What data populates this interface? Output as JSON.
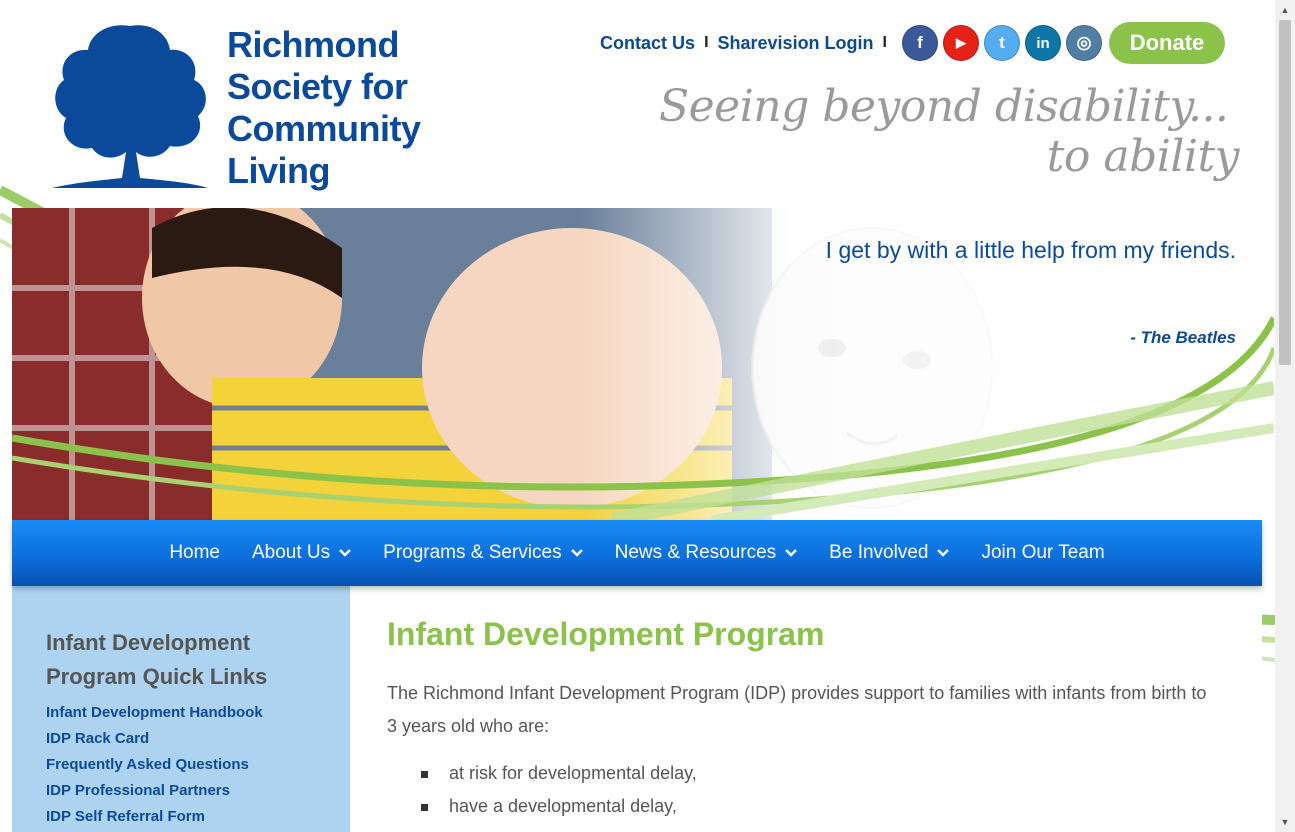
{
  "org": {
    "name_lines": [
      "Richmond",
      "Society for",
      "Community",
      "Living"
    ]
  },
  "header": {
    "links": [
      "Contact Us",
      "Sharevision Login"
    ],
    "separator": "I",
    "social": [
      {
        "name": "facebook",
        "glyph": "f",
        "color": "#3b5998"
      },
      {
        "name": "youtube",
        "glyph": "▶",
        "color": "#e62117"
      },
      {
        "name": "twitter",
        "glyph": "t",
        "color": "#55acee"
      },
      {
        "name": "linkedin",
        "glyph": "in",
        "color": "#0e76a8"
      },
      {
        "name": "instagram",
        "glyph": "◎",
        "color": "#517fa4"
      }
    ],
    "donate": "Donate",
    "tagline_line1": "Seeing beyond disability...",
    "tagline_line2": "to ability"
  },
  "hero": {
    "quote": "I get by with a little help from my friends.",
    "author": "- The Beatles"
  },
  "nav": {
    "items": [
      {
        "label": "Home",
        "dropdown": false
      },
      {
        "label": "About Us",
        "dropdown": true
      },
      {
        "label": "Programs & Services",
        "dropdown": true
      },
      {
        "label": "News & Resources",
        "dropdown": true
      },
      {
        "label": "Be Involved",
        "dropdown": true
      },
      {
        "label": "Join Our Team",
        "dropdown": false
      }
    ]
  },
  "sidebar": {
    "title": "Infant Development Program Quick Links",
    "links": [
      "Infant Development Handbook",
      "IDP Rack Card",
      "Frequently Asked Questions",
      "IDP Professional Partners",
      "IDP Self Referral Form"
    ]
  },
  "main": {
    "title": "Infant Development Program",
    "intro": "The Richmond Infant Development Program (IDP) provides support to families with infants from birth to 3 years old who are:",
    "bullets": [
      "at risk for developmental delay,",
      "have a developmental delay,"
    ]
  },
  "colors": {
    "brand_blue": "#0b4a9a",
    "accent_green": "#8bc34a",
    "nav_blue": "#0c6fdc",
    "sidebar_bg": "#aed3f0"
  },
  "icons": {
    "scroll_up": "▲",
    "scroll_down": "▼"
  }
}
